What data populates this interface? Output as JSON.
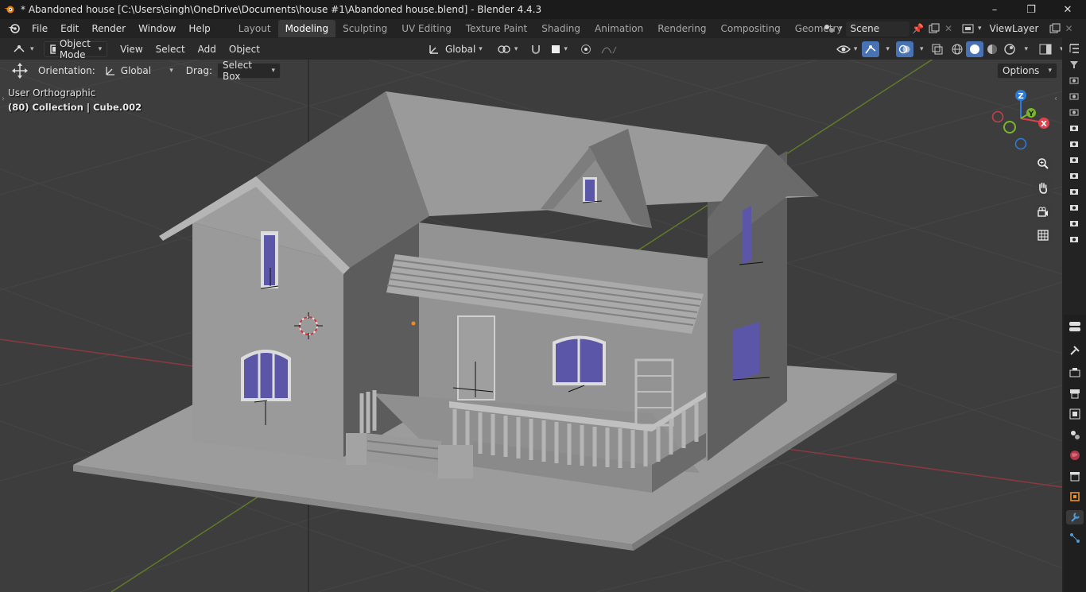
{
  "window": {
    "title": "* Abandoned house [C:\\Users\\singh\\OneDrive\\Documents\\house #1\\Abandoned house.blend] - Blender 4.4.3",
    "controls": [
      "–",
      "❐",
      "✕"
    ]
  },
  "menu": [
    "File",
    "Edit",
    "Render",
    "Window",
    "Help"
  ],
  "workspaces": [
    {
      "label": "Layout",
      "active": false
    },
    {
      "label": "Modeling",
      "active": true
    },
    {
      "label": "Sculpting",
      "active": false
    },
    {
      "label": "UV Editing",
      "active": false
    },
    {
      "label": "Texture Paint",
      "active": false
    },
    {
      "label": "Shading",
      "active": false
    },
    {
      "label": "Animation",
      "active": false
    },
    {
      "label": "Rendering",
      "active": false
    },
    {
      "label": "Compositing",
      "active": false
    },
    {
      "label": "Geometry Node",
      "active": false
    }
  ],
  "scene": {
    "value": "Scene"
  },
  "view_layer": {
    "value": "ViewLayer"
  },
  "header": {
    "mode": "Object Mode",
    "menus": [
      "View",
      "Select",
      "Add",
      "Object"
    ],
    "transform_orientation": "Global"
  },
  "tool_header": {
    "orientation_label": "Orientation:",
    "orientation_value": "Global",
    "drag_label": "Drag:",
    "drag_value": "Select Box",
    "options": "Options"
  },
  "viewport": {
    "view_name": "User Orthographic",
    "collection_info": "(80) Collection | Cube.002"
  },
  "gizmo": {
    "x": "X",
    "y": "Y",
    "z": "Z"
  },
  "colors": {
    "accent": "#4772b3",
    "window": "#5c56a8",
    "x_axis": "#e0414b",
    "y_axis": "#7ab62a",
    "z_axis": "#2f7ad6"
  }
}
